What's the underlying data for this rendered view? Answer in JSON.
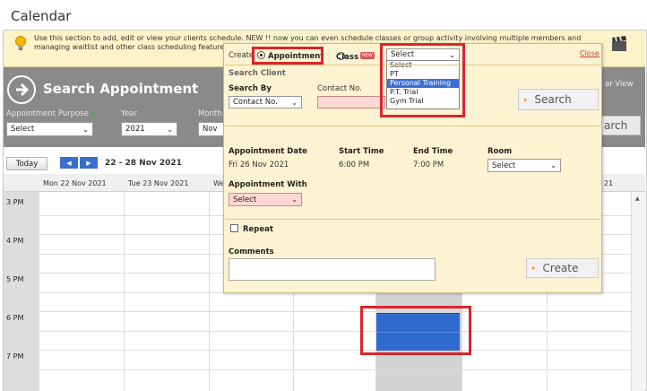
{
  "page": {
    "title": "Calendar"
  },
  "info": {
    "text": "Use this section to add, edit or view your clients schedule. NEW !! now you can even schedule classes or group activity involving multiple members and managing waitlist and other class scheduling features studios."
  },
  "search_panel": {
    "title": "Search Appointment",
    "purpose_label": "Appointment Purpose",
    "purpose_value": "Select",
    "year_label": "Year",
    "year_value": "2021",
    "month_label": "Month",
    "month_value": "Nov",
    "right_label": "ar View",
    "search_button": "arch"
  },
  "calendar": {
    "today_button": "Today",
    "range": "22 - 28 Nov 2021",
    "days": [
      "Mon 22 Nov 2021",
      "Tue 23 Nov 2021",
      "We",
      "21"
    ],
    "times": [
      "3 PM",
      "4 PM",
      "5 PM",
      "6 PM",
      "7 PM"
    ]
  },
  "modal": {
    "create_label": "Create",
    "appointment_option": "Appointment",
    "class_option": "Class",
    "new_badge": "NEW",
    "type_select_value": "Select",
    "close_link": "Close",
    "type_options": [
      "Select",
      "PT",
      "Personal Training",
      "P.T. Trial",
      "Gym Trial"
    ],
    "search_client_header": "Search Client",
    "search_by_label": "Search By",
    "search_by_value": "Contact No.",
    "contact_no_label": "Contact No.",
    "search_button": "Search",
    "appt_date_label": "Appointment Date",
    "appt_date_value": "Fri 26 Nov 2021",
    "start_time_label": "Start Time",
    "start_time_value": "6:00 PM",
    "end_time_label": "End Time",
    "end_time_value": "7:00 PM",
    "room_label": "Room",
    "room_value": "Select",
    "appt_with_label": "Appointment With",
    "appt_with_value": "Select",
    "repeat_label": "Repeat",
    "comments_label": "Comments",
    "create_button": "Create"
  },
  "colors": {
    "accent": "#3b6fcf",
    "highlight": "#d9262c",
    "panel": "#fdf3d2"
  }
}
